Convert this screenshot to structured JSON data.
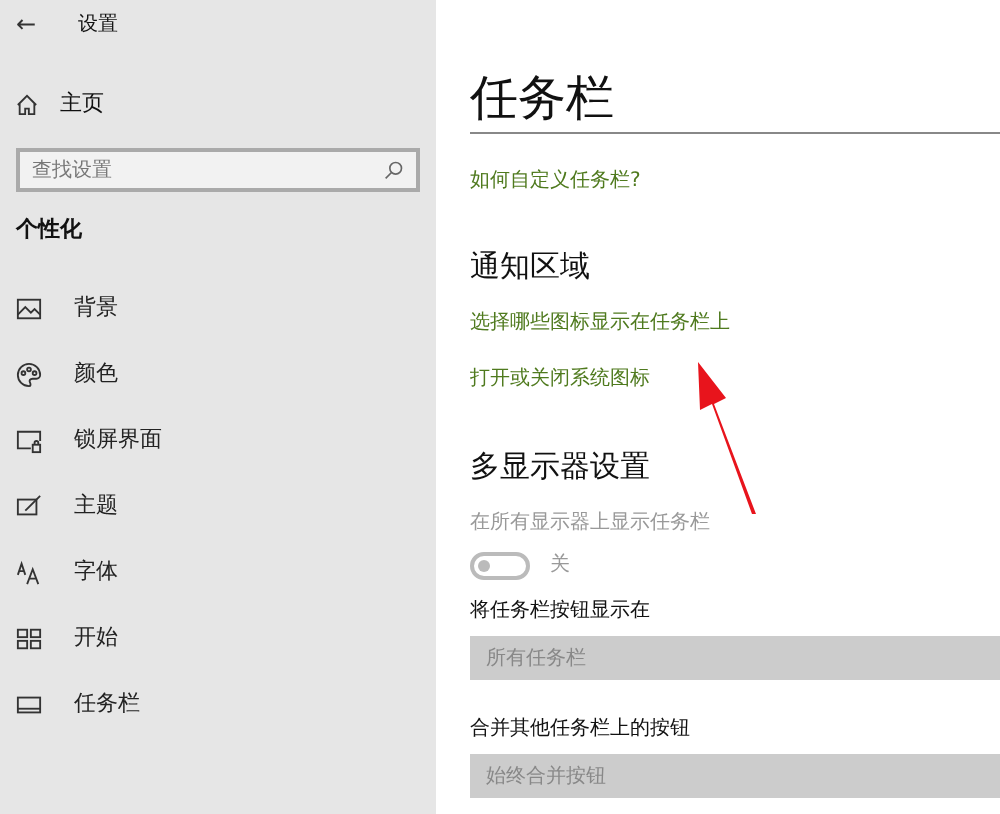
{
  "sidebar": {
    "back": "←",
    "title": "设置",
    "home": "主页",
    "search": {
      "placeholder": "查找设置"
    },
    "section": "个性化",
    "items": [
      {
        "label": "背景",
        "kind": "background"
      },
      {
        "label": "颜色",
        "kind": "color"
      },
      {
        "label": "锁屏界面",
        "kind": "lock"
      },
      {
        "label": "主题",
        "kind": "theme"
      },
      {
        "label": "字体",
        "kind": "font"
      },
      {
        "label": "开始",
        "kind": "start"
      },
      {
        "label": "任务栏",
        "kind": "taskbar"
      }
    ]
  },
  "main": {
    "title": "任务栏",
    "help_link": "如何自定义任务栏?",
    "notification": {
      "heading": "通知区域",
      "links": [
        "选择哪些图标显示在任务栏上",
        "打开或关闭系统图标"
      ]
    },
    "multi_display": {
      "heading": "多显示器设置",
      "show_all": {
        "label": "在所有显示器上显示任务栏",
        "disabled": true,
        "on": false,
        "state_text": "关"
      },
      "dropdowns": [
        {
          "label": "将任务栏按钮显示在",
          "value": "所有任务栏",
          "disabled": true
        },
        {
          "label": "合并其他任务栏上的按钮",
          "value": "始终合并按钮",
          "disabled": true
        }
      ]
    }
  }
}
